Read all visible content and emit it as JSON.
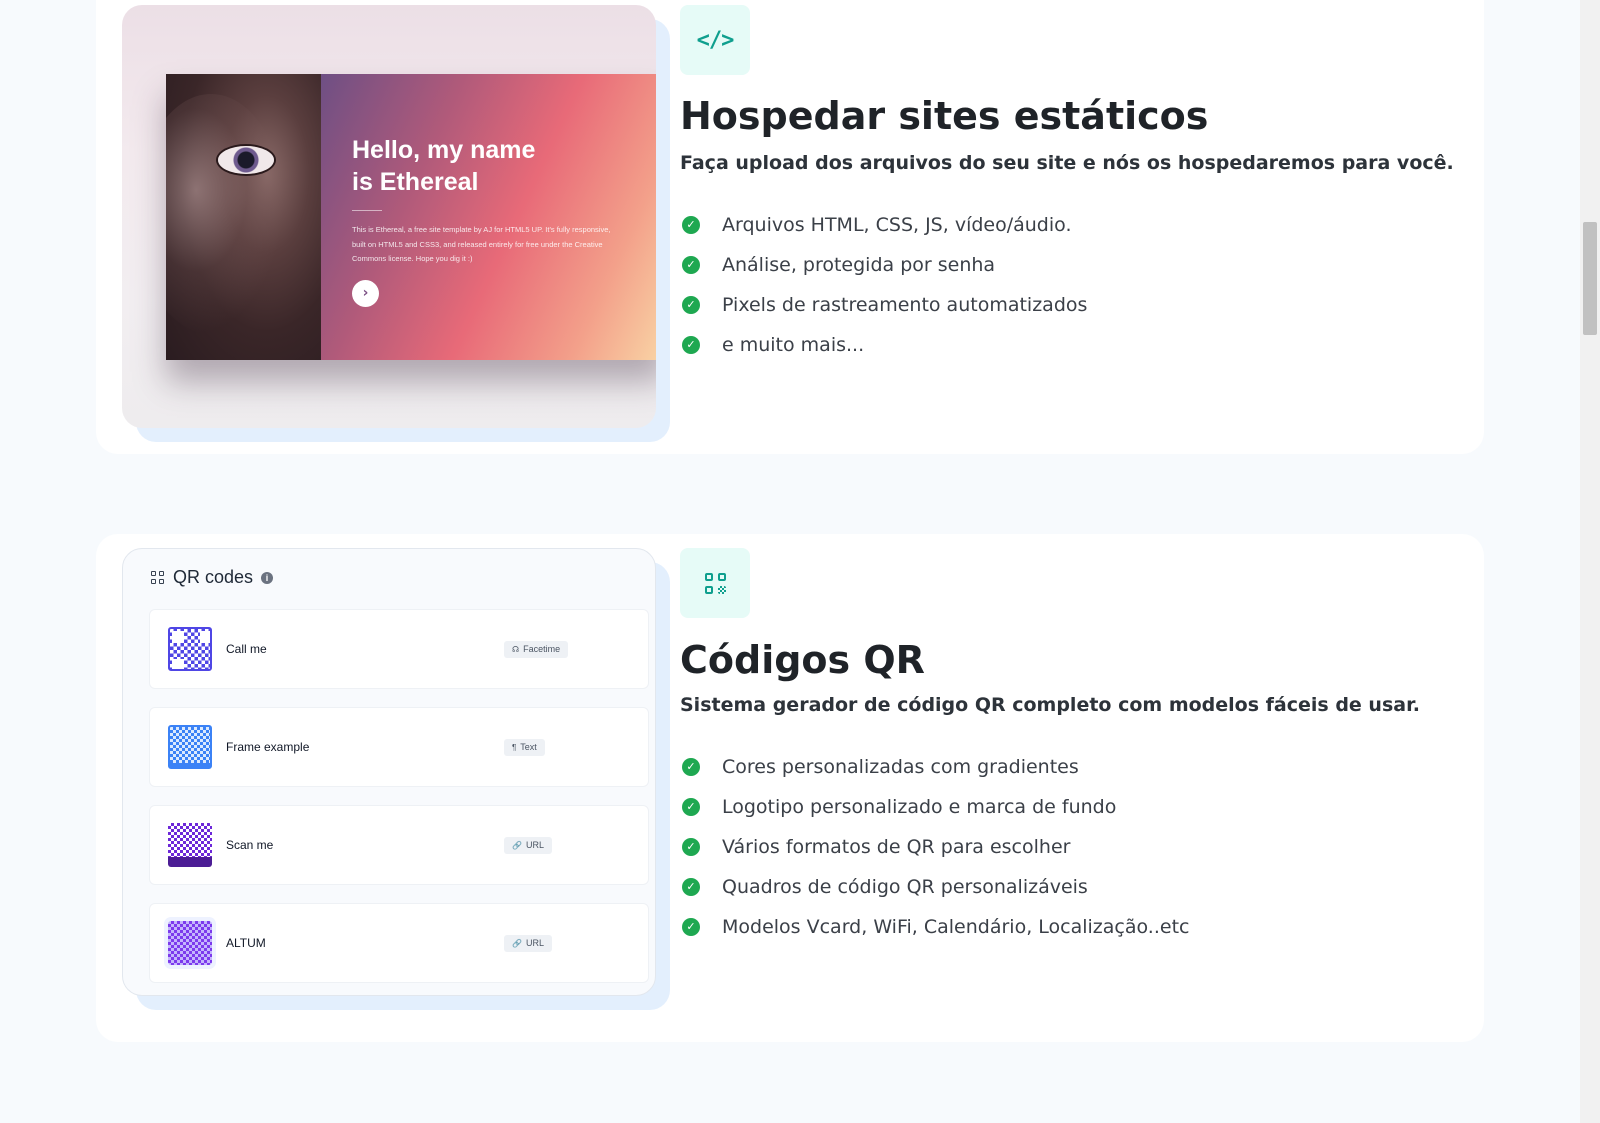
{
  "hosting": {
    "preview": {
      "hero_title": "Hello, my name is Ethereal",
      "hero_body": "This is Ethereal, a free site template by AJ for HTML5 UP. It's fully responsive, built on HTML5 and CSS3, and released entirely for free under the Creative Commons license. Hope you dig it :)",
      "arrow": "›"
    },
    "icon": "code-icon",
    "icon_glyph": "</>",
    "title": "Hospedar sites estáticos",
    "subtitle": "Faça upload dos arquivos do seu site e nós os hospedaremos para você.",
    "features": [
      "Arquivos HTML, CSS, JS, vídeo/áudio.",
      "Análise, protegida por senha",
      "Pixels de rastreamento automatizados",
      "e muito mais..."
    ]
  },
  "qr": {
    "preview": {
      "header": "QR codes",
      "info_glyph": "i",
      "items": [
        {
          "name": "Call me",
          "tag": "Facetime",
          "tag_icon": "headset-icon",
          "tag_glyph": "☊"
        },
        {
          "name": "Frame example",
          "tag": "Text",
          "tag_icon": "paragraph-icon",
          "tag_glyph": "¶"
        },
        {
          "name": "Scan me",
          "tag": "URL",
          "tag_icon": "link-icon",
          "tag_glyph": "🔗"
        },
        {
          "name": "ALTUM",
          "tag": "URL",
          "tag_icon": "link-icon",
          "tag_glyph": "🔗"
        }
      ]
    },
    "icon": "qr-code-icon",
    "title": "Códigos QR",
    "subtitle": "Sistema gerador de código QR completo com modelos fáceis de usar.",
    "features": [
      "Cores personalizadas com gradientes",
      "Logotipo personalizado e marca de fundo",
      "Vários formatos de QR para escolher",
      "Quadros de código QR personalizáveis",
      "Modelos Vcard, WiFi, Calendário, Localização..etc"
    ]
  },
  "check_glyph": "✓",
  "colors": {
    "accent_teal": "#0f9f8e",
    "icon_bg": "#e6fbf7",
    "check_green": "#1ea851",
    "page_bg": "#f7fafd"
  }
}
